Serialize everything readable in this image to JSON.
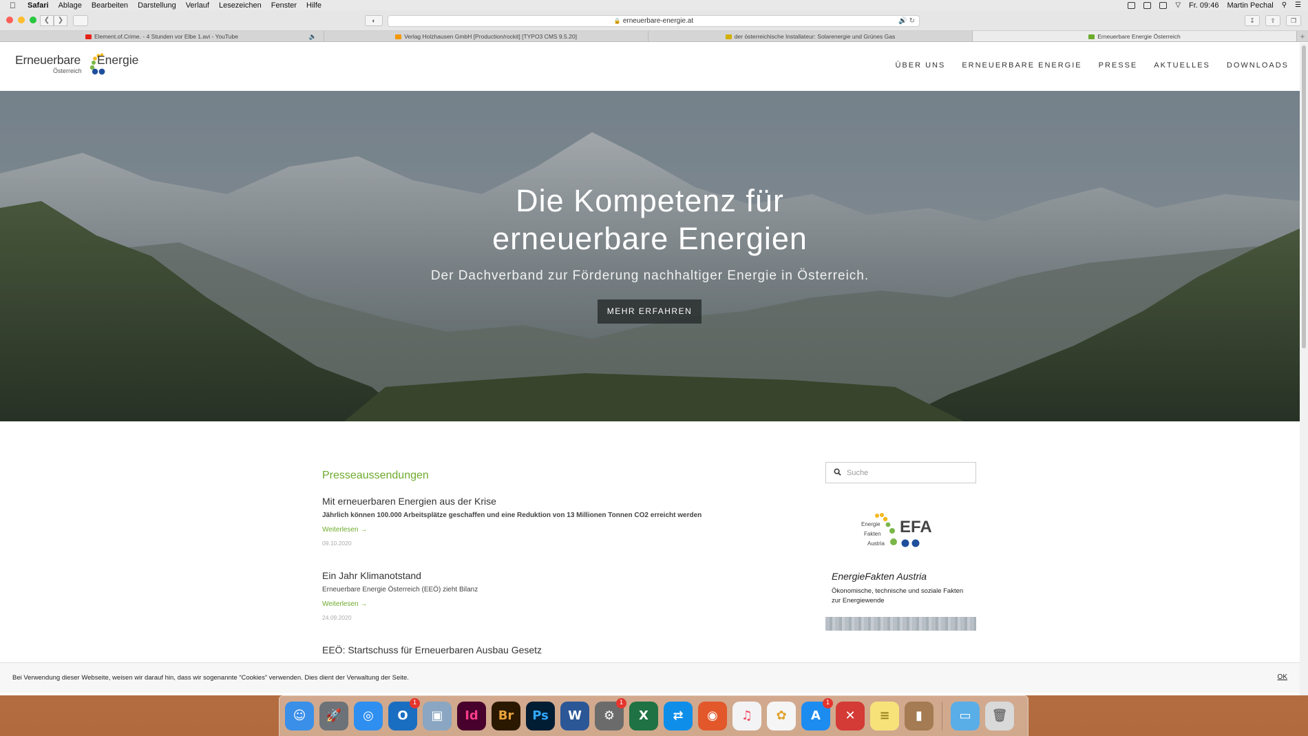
{
  "menubar": {
    "app": "Safari",
    "items": [
      "Ablage",
      "Bearbeiten",
      "Darstellung",
      "Verlauf",
      "Lesezeichen",
      "Fenster",
      "Hilfe"
    ],
    "clock": "Fr. 09:46",
    "user": "Martin Pechal"
  },
  "browser": {
    "url": "erneuerbare-energie.at",
    "tabs": [
      {
        "label": "Element.of.Crime. - 4 Stunden vor Elbe 1.avi - YouTube",
        "favicon_color": "#e62117"
      },
      {
        "label": "Verlag Holzhausen GmbH [Production/rockit] [TYPO3 CMS 9.5.20]",
        "favicon_color": "#f49700"
      },
      {
        "label": "der österreichische Installateur: Solarenergie und Grünes Gas",
        "favicon_color": "#d4b000"
      },
      {
        "label": "Erneuerbare Energie Österreich",
        "favicon_color": "#6dab2c"
      }
    ]
  },
  "site": {
    "logo": {
      "word1": "Erneuerbare",
      "word2": "Energie",
      "sub": "Österreich"
    },
    "nav": [
      "ÜBER UNS",
      "ERNEUERBARE ENERGIE",
      "PRESSE",
      "AKTUELLES",
      "DOWNLOADS"
    ],
    "hero": {
      "title_line1": "Die Kompetenz für",
      "title_line2": "erneuerbare Energien",
      "subtitle": "Der Dachverband zur Förderung nachhaltiger Energie in Österreich.",
      "button": "MEHR ERFAHREN"
    },
    "press": {
      "heading": "Presseaussendungen",
      "articles": [
        {
          "title": "Mit erneuerbaren Energien aus der Krise",
          "summary": "Jährlich können 100.000 Arbeitsplätze geschaffen und eine Reduktion von 13 Millionen Tonnen CO2 erreicht werden",
          "more": "Weiterlesen →",
          "date": "09.10.2020"
        },
        {
          "title": "Ein Jahr Klimanotstand",
          "summary": "Erneuerbare Energie Österreich (EEÖ) zieht Bilanz",
          "more": "Weiterlesen →",
          "date": "24.09.2020"
        },
        {
          "title": "EEÖ: Startschuss für Erneuerbaren Ausbau Gesetz"
        }
      ]
    },
    "sidebar": {
      "search_placeholder": "Suche",
      "efa_logo_text": "EFA",
      "efa_logo_words": [
        "Energie",
        "Fakten",
        "Austria"
      ],
      "efa_title": "EnergieFakten Austria",
      "efa_text": "Ökonomische, technische und soziale Fakten zur Energiewende"
    },
    "cookie": {
      "text": "Bei Verwendung dieser Webseite, weisen wir darauf hin, dass wir sogenannte “Cookies” verwenden. Dies dient der Verwaltung der Seite.",
      "ok": "OK"
    }
  },
  "dock": [
    {
      "name": "finder-icon",
      "color": "#3a8fe8",
      "glyph": "☺"
    },
    {
      "name": "launchpad-icon",
      "color": "#6c7278",
      "glyph": "🚀"
    },
    {
      "name": "safari-icon",
      "color": "#2f8ff0",
      "glyph": "◎"
    },
    {
      "name": "outlook-icon",
      "color": "#1a6ec2",
      "glyph": "O",
      "badge": "1"
    },
    {
      "name": "preview-icon",
      "color": "#8aa6c2",
      "glyph": "▣"
    },
    {
      "name": "indesign-icon",
      "color": "#48002c",
      "glyph": "Id",
      "text_color": "#ff3d8b"
    },
    {
      "name": "bridge-icon",
      "color": "#2b1800",
      "glyph": "Br",
      "text_color": "#e8a33c"
    },
    {
      "name": "photoshop-icon",
      "color": "#001d34",
      "glyph": "Ps",
      "text_color": "#31a8ff"
    },
    {
      "name": "word-icon",
      "color": "#2b5797",
      "glyph": "W"
    },
    {
      "name": "system-preferences-icon",
      "color": "#6b6b6b",
      "glyph": "⚙",
      "badge": "1"
    },
    {
      "name": "excel-icon",
      "color": "#1f7244",
      "glyph": "X"
    },
    {
      "name": "teamviewer-icon",
      "color": "#0e8ee9",
      "glyph": "⇄"
    },
    {
      "name": "firefox-icon",
      "color": "#e2582b",
      "glyph": "◉"
    },
    {
      "name": "music-icon",
      "color": "#f3f3f5",
      "glyph": "♫",
      "text_color": "#f0405a"
    },
    {
      "name": "photos-icon",
      "color": "#f5f5f5",
      "glyph": "✿",
      "text_color": "#e0a02a"
    },
    {
      "name": "app-store-icon",
      "color": "#1d8cf0",
      "glyph": "A",
      "badge": "1"
    },
    {
      "name": "remote-desktop-icon",
      "color": "#d43a36",
      "glyph": "✕"
    },
    {
      "name": "notes-icon",
      "color": "#f7e27a",
      "glyph": "≡",
      "text_color": "#9a8420"
    },
    {
      "name": "contacts-icon",
      "color": "#a47b52",
      "glyph": "▮"
    },
    {
      "name": "downloads-folder-icon",
      "color": "#5aaee8",
      "glyph": "▭",
      "separator_before": true
    },
    {
      "name": "trash-icon",
      "color": "#d9d9d9",
      "glyph": "🗑",
      "text_color": "#777"
    }
  ]
}
